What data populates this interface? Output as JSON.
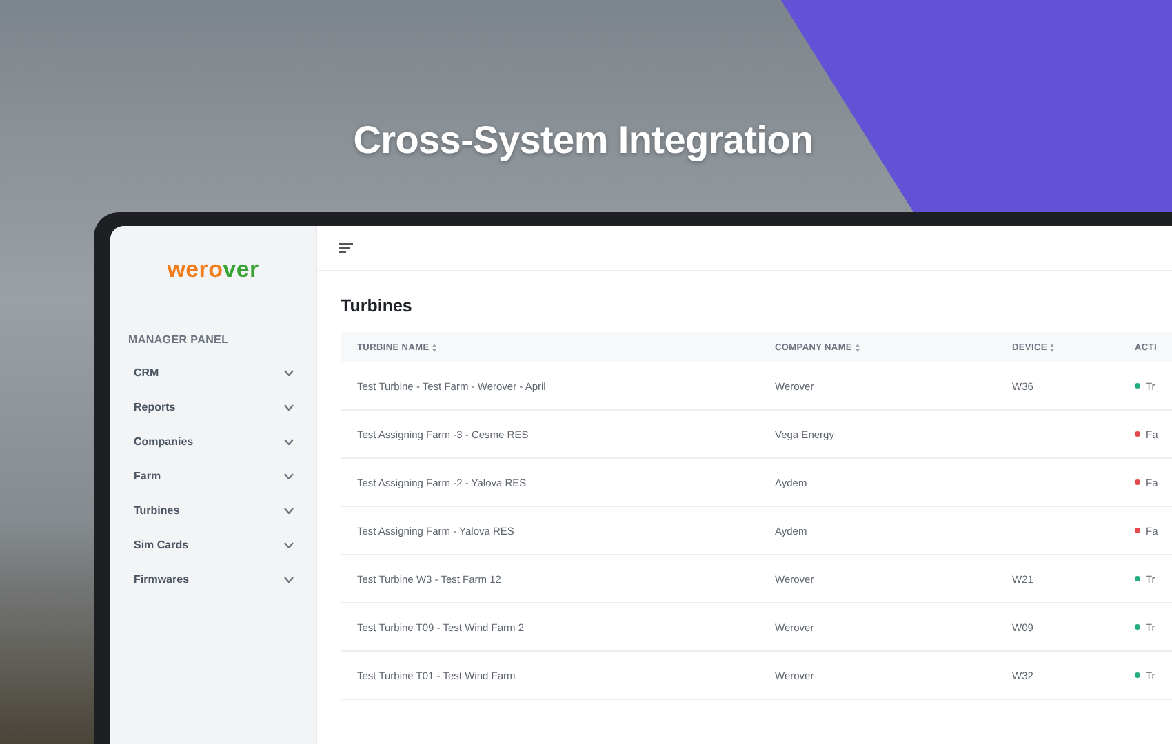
{
  "headline": "Cross-System Integration",
  "sidebar": {
    "logo": "werover",
    "section_title": "MANAGER PANEL",
    "items": [
      {
        "label": "CRM",
        "expanded": false
      },
      {
        "label": "Reports",
        "expanded": false
      },
      {
        "label": "Companies",
        "expanded": false
      },
      {
        "label": "Farm",
        "expanded": false
      },
      {
        "label": "Turbines",
        "expanded": false
      },
      {
        "label": "Sim Cards",
        "expanded": false
      },
      {
        "label": "Firmwares",
        "expanded": false
      }
    ]
  },
  "page_title": "Turbines",
  "table": {
    "columns": [
      {
        "label": "TURBINE NAME",
        "sortable": true
      },
      {
        "label": "COMPANY NAME",
        "sortable": true
      },
      {
        "label": "DEVICE",
        "sortable": true
      },
      {
        "label": "ACTI",
        "sortable": false
      }
    ],
    "rows": [
      {
        "turbine": "Test Turbine - Test Farm - Werover - April",
        "company": "Werover",
        "device": "W36",
        "active": "Tr",
        "color": "#22b07d"
      },
      {
        "turbine": "Test Assigning Farm -3 - Cesme RES",
        "company": "Vega Energy",
        "device": "",
        "active": "Fa",
        "color": "#e5484d"
      },
      {
        "turbine": "Test Assigning Farm -2 - Yalova RES",
        "company": "Aydem",
        "device": "",
        "active": "Fa",
        "color": "#e5484d"
      },
      {
        "turbine": "Test Assigning Farm - Yalova RES",
        "company": "Aydem",
        "device": "",
        "active": "Fa",
        "color": "#e5484d"
      },
      {
        "turbine": "Test Turbine W3 - Test Farm 12",
        "company": "Werover",
        "device": "W21",
        "active": "Tr",
        "color": "#22b07d"
      },
      {
        "turbine": "Test Turbine T09 - Test Wind Farm 2",
        "company": "Werover",
        "device": "W09",
        "active": "Tr",
        "color": "#22b07d"
      },
      {
        "turbine": "Test Turbine T01 - Test Wind Farm",
        "company": "Werover",
        "device": "W32",
        "active": "Tr",
        "color": "#22b07d"
      }
    ]
  }
}
